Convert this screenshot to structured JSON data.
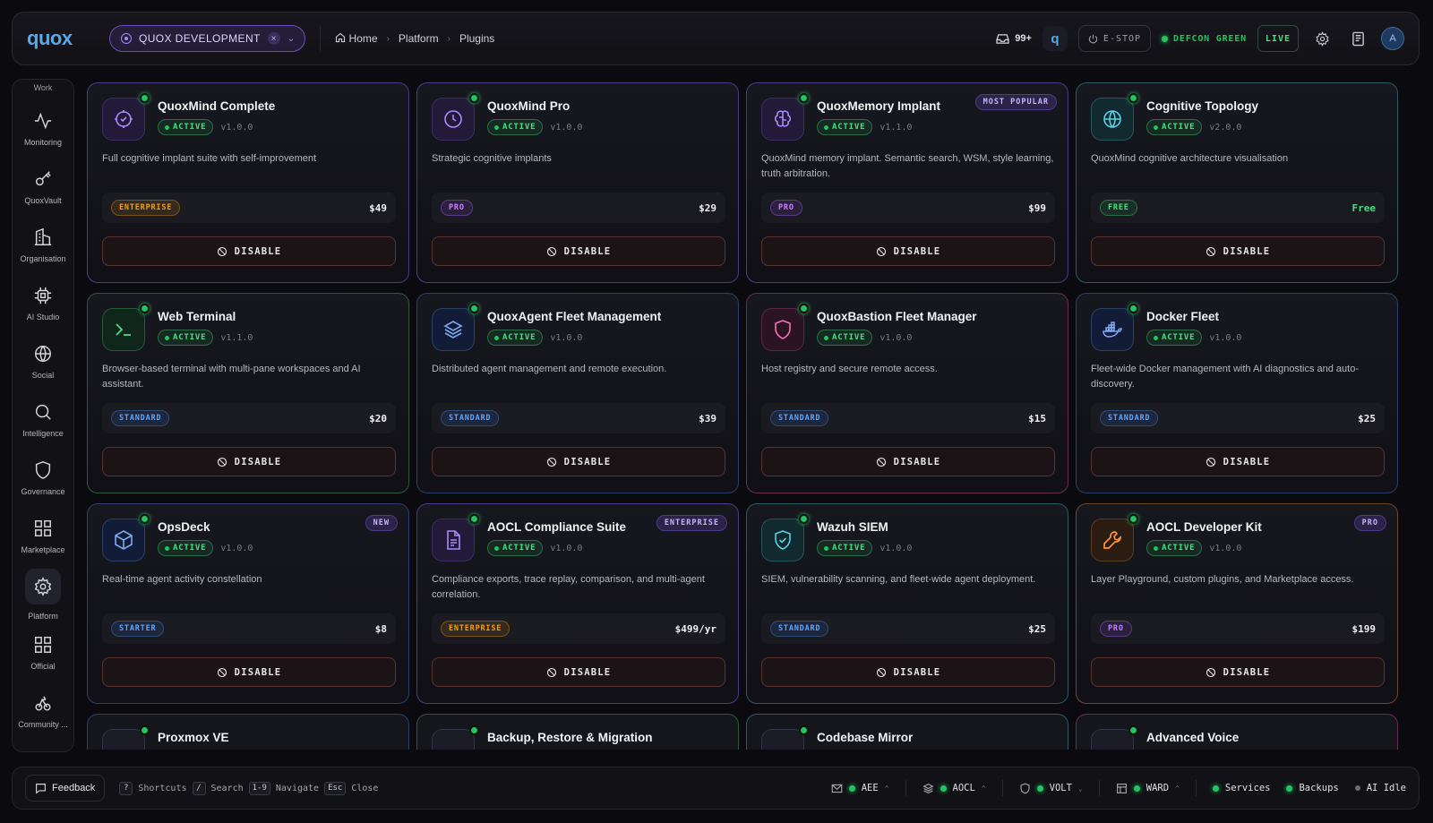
{
  "header": {
    "logo": "quox",
    "project": "QUOX DEVELOPMENT",
    "breadcrumb": [
      "Home",
      "Platform",
      "Plugins"
    ],
    "inbox_count": "99+",
    "estop_label": "E-STOP",
    "defcon_label": "DEFCON GREEN",
    "live_label": "LIVE",
    "avatar_initial": "A"
  },
  "sidebar": {
    "heading": "Work",
    "items": [
      {
        "label": "Monitoring",
        "icon": "activity-icon"
      },
      {
        "label": "QuoxVault",
        "icon": "key-icon"
      },
      {
        "label": "Organisation",
        "icon": "building-icon"
      },
      {
        "label": "AI Studio",
        "icon": "chip-icon"
      },
      {
        "label": "Social",
        "icon": "globe-icon"
      },
      {
        "label": "Intelligence",
        "icon": "search-icon"
      },
      {
        "label": "Governance",
        "icon": "shield-icon"
      },
      {
        "label": "Marketplace",
        "icon": "grid-icon"
      },
      {
        "label": "Platform",
        "icon": "gear-icon"
      },
      {
        "label": "Official",
        "icon": "grid-icon"
      },
      {
        "label": "Community ...",
        "icon": "community-icon"
      }
    ]
  },
  "plugins": [
    {
      "title": "QuoxMind Complete",
      "status": "ACTIVE",
      "version": "v1.0.0",
      "desc": "Full cognitive implant suite with self-improvement",
      "tier": "ENTERPRISE",
      "price": "$49",
      "button": "DISABLE"
    },
    {
      "title": "QuoxMind Pro",
      "status": "ACTIVE",
      "version": "v1.0.0",
      "desc": "Strategic cognitive implants",
      "tier": "PRO",
      "price": "$29",
      "button": "DISABLE"
    },
    {
      "title": "QuoxMemory Implant",
      "status": "ACTIVE",
      "version": "v1.1.0",
      "tag": "MOST POPULAR",
      "desc": "QuoxMind memory implant. Semantic search, WSM, style learning, truth arbitration.",
      "tier": "PRO",
      "price": "$99",
      "button": "DISABLE"
    },
    {
      "title": "Cognitive Topology",
      "status": "ACTIVE",
      "version": "v2.0.0",
      "desc": "QuoxMind cognitive architecture visualisation",
      "tier": "FREE",
      "price": "Free",
      "button": "DISABLE"
    },
    {
      "title": "Web Terminal",
      "status": "ACTIVE",
      "version": "v1.1.0",
      "desc": "Browser-based terminal with multi-pane workspaces and AI assistant.",
      "tier": "STANDARD",
      "price": "$20",
      "button": "DISABLE"
    },
    {
      "title": "QuoxAgent Fleet Management",
      "status": "ACTIVE",
      "version": "v1.0.0",
      "desc": "Distributed agent management and remote execution.",
      "tier": "STANDARD",
      "price": "$39",
      "button": "DISABLE"
    },
    {
      "title": "QuoxBastion Fleet Manager",
      "status": "ACTIVE",
      "version": "v1.0.0",
      "desc": "Host registry and secure remote access.",
      "tier": "STANDARD",
      "price": "$15",
      "button": "DISABLE"
    },
    {
      "title": "Docker Fleet",
      "status": "ACTIVE",
      "version": "v1.0.0",
      "desc": "Fleet-wide Docker management with AI diagnostics and auto-discovery.",
      "tier": "STANDARD",
      "price": "$25",
      "button": "DISABLE"
    },
    {
      "title": "OpsDeck",
      "status": "ACTIVE",
      "version": "v1.0.0",
      "tag": "NEW",
      "desc": "Real-time agent activity constellation",
      "tier": "STARTER",
      "price": "$8",
      "button": "DISABLE"
    },
    {
      "title": "AOCL Compliance Suite",
      "status": "ACTIVE",
      "version": "v1.0.0",
      "tag": "ENTERPRISE",
      "desc": "Compliance exports, trace replay, comparison, and multi-agent correlation.",
      "tier": "ENTERPRISE",
      "price": "$499/yr",
      "button": "DISABLE"
    },
    {
      "title": "Wazuh SIEM",
      "status": "ACTIVE",
      "version": "v1.0.0",
      "desc": "SIEM, vulnerability scanning, and fleet-wide agent deployment.",
      "tier": "STANDARD",
      "price": "$25",
      "button": "DISABLE"
    },
    {
      "title": "AOCL Developer Kit",
      "status": "ACTIVE",
      "version": "v1.0.0",
      "tag": "PRO",
      "desc": "Layer Playground, custom plugins, and Marketplace access.",
      "tier": "PRO",
      "price": "$199",
      "button": "DISABLE"
    }
  ],
  "plugins_partial": [
    "Proxmox VE",
    "Backup, Restore & Migration",
    "Codebase Mirror",
    "Advanced Voice"
  ],
  "footer": {
    "feedback": "Feedback",
    "shortcuts": [
      {
        "key": "?",
        "label": "Shortcuts"
      },
      {
        "key": "/",
        "label": "Search"
      },
      {
        "key": "1-9",
        "label": "Navigate"
      },
      {
        "key": "Esc",
        "label": "Close"
      }
    ],
    "status": [
      "AEE",
      "AOCL",
      "VOLT",
      "WARD"
    ],
    "services": "Services",
    "backups": "Backups",
    "ai_state": "AI Idle"
  }
}
